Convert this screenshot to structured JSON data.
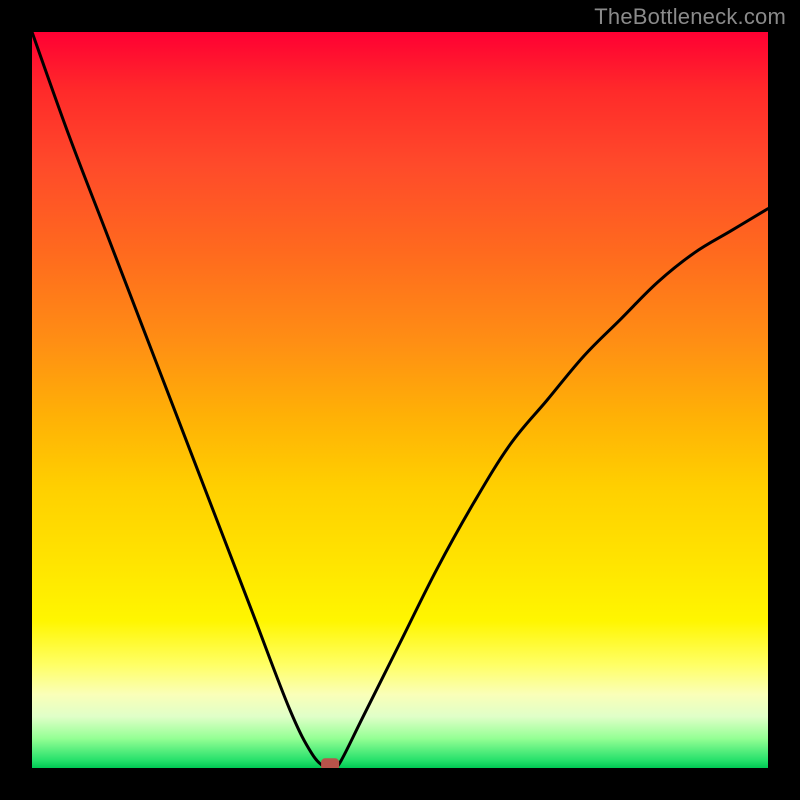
{
  "watermark": "TheBottleneck.com",
  "chart_data": {
    "type": "line",
    "title": "",
    "xlabel": "",
    "ylabel": "",
    "xlim": [
      0,
      1
    ],
    "ylim": [
      0,
      1
    ],
    "legend": false,
    "grid": false,
    "background": "spectral-gradient-red-to-green",
    "series": [
      {
        "name": "bottleneck-curve",
        "color": "#000000",
        "x": [
          0.0,
          0.05,
          0.1,
          0.15,
          0.2,
          0.25,
          0.3,
          0.35,
          0.38,
          0.4,
          0.41,
          0.42,
          0.45,
          0.5,
          0.55,
          0.6,
          0.65,
          0.7,
          0.75,
          0.8,
          0.85,
          0.9,
          0.95,
          1.0
        ],
        "y": [
          1.0,
          0.86,
          0.73,
          0.6,
          0.47,
          0.34,
          0.21,
          0.08,
          0.02,
          0.0,
          0.0,
          0.01,
          0.07,
          0.17,
          0.27,
          0.36,
          0.44,
          0.5,
          0.56,
          0.61,
          0.66,
          0.7,
          0.73,
          0.76
        ]
      }
    ],
    "marker": {
      "name": "min-marker",
      "x": 0.405,
      "y": 0.005,
      "color": "#b8534a",
      "shape": "rounded-rect"
    }
  }
}
